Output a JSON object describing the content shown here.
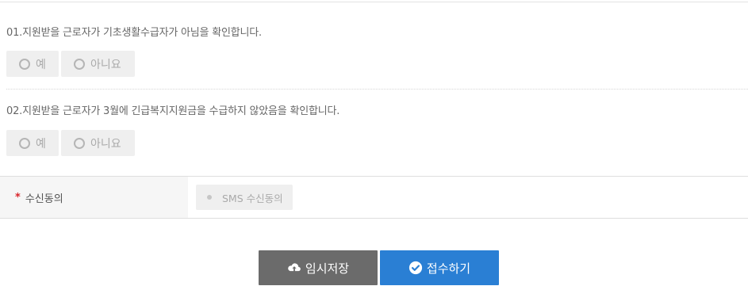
{
  "questions": [
    {
      "text": "01.지원받을 근로자가 기초생활수급자가 아님을 확인합니다.",
      "options": [
        "예",
        "아니요"
      ]
    },
    {
      "text": "02.지원받을 근로자가 3월에 긴급복지지원금을 수급하지 않았음을 확인합니다.",
      "options": [
        "예",
        "아니요"
      ]
    }
  ],
  "consent": {
    "required_mark": "*",
    "label": "수신동의",
    "sms_option": "SMS 수신동의"
  },
  "buttons": {
    "temp_save": "임시저장",
    "submit": "접수하기"
  },
  "colors": {
    "submit_bg": "#2a7fd4",
    "temp_save_bg": "#6b6b6b",
    "required_mark": "#d9262b"
  }
}
